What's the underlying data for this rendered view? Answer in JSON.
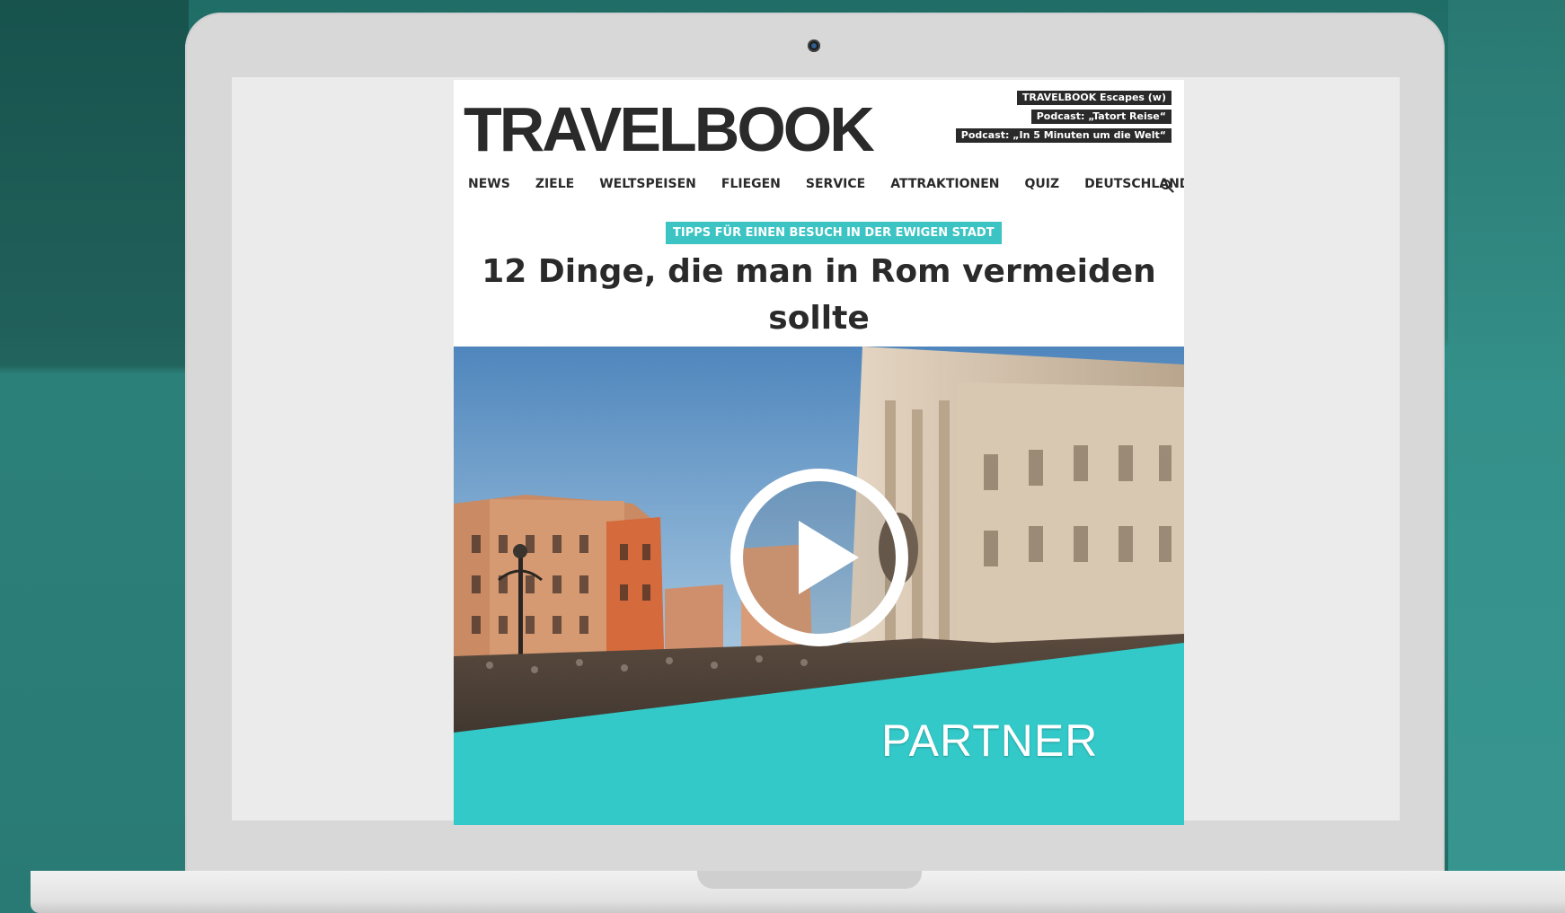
{
  "site": {
    "logo": "TRAVELBOOK",
    "promo_links": [
      "TRAVELBOOK Escapes (w)",
      "Podcast: „Tatort Reise“",
      "Podcast: „In 5 Minuten um die Welt“"
    ],
    "nav": [
      "NEWS",
      "ZIELE",
      "WELTSPEISEN",
      "FLIEGEN",
      "SERVICE",
      "ATTRAKTIONEN",
      "QUIZ",
      "DEUTSCHLAND"
    ],
    "search_icon": "search-icon"
  },
  "article": {
    "kicker": "TIPPS FÜR EINEN BESUCH IN DER EWIGEN STADT",
    "headline": "12 Dinge, die man in Rom vermeiden sollte"
  },
  "video": {
    "play_icon": "play-icon",
    "badge": "PARTNER"
  },
  "colors": {
    "accent": "#3cc3c3",
    "badge": "#33c9c9",
    "text": "#2a2a2a"
  }
}
